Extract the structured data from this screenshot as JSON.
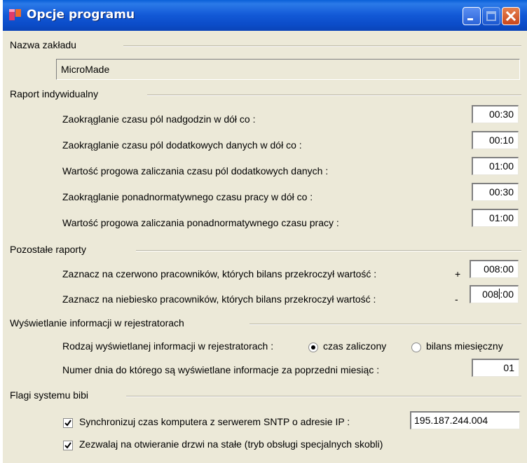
{
  "window": {
    "title": "Opcje programu"
  },
  "titlebar_buttons": {
    "minimize": "minimize-icon",
    "maximize": "maximize-icon",
    "close": "close-icon"
  },
  "company": {
    "group_label": "Nazwa zakładu",
    "value": "MicroMade"
  },
  "individual_report": {
    "group_label": "Raport indywidualny",
    "rows": [
      {
        "label": "Zaokrąglanie czasu pól nadgodzin w dół co :",
        "value": "00:30"
      },
      {
        "label": "Zaokrąglanie czasu pól dodatkowych danych w dół co :",
        "value": "00:10"
      },
      {
        "label": "Wartość progowa zaliczania czasu pól dodatkowych danych :",
        "value": "01:00"
      },
      {
        "label": "Zaokrąglanie ponadnormatywnego czasu pracy w dół co :",
        "value": "00:30"
      },
      {
        "label": "Wartość progowa zaliczania ponadnormatywnego czasu pracy :",
        "value": "01:00"
      }
    ]
  },
  "other_reports": {
    "group_label": "Pozostałe raporty",
    "rows": [
      {
        "label": "Zaznacz na czerwono pracowników, których bilans przekroczył wartość :",
        "sign": "+",
        "value": "008:00"
      },
      {
        "label": "Zaznacz na niebiesko pracowników, których bilans przekroczył wartość :",
        "sign": "-",
        "value_before_cursor": "008",
        "value_after_cursor": ":00"
      }
    ]
  },
  "recorder_display": {
    "group_label": "Wyświetlanie informacji w rejestratorach",
    "type_label": "Rodzaj wyświetlanej informacji w rejestratorach :",
    "option_credited": "czas zaliczony",
    "option_balance": "bilans miesięczny",
    "selected": "czas zaliczony",
    "day_label": "Numer dnia do którego są wyświetlane informacje za poprzedni miesiąc :",
    "day_value": "01"
  },
  "bibi_flags": {
    "group_label": "Flagi systemu bibi",
    "sntp_label": "Synchronizuj czas komputera z serwerem SNTP o adresie IP :",
    "sntp_checked": true,
    "sntp_ip": "195.187.244.004",
    "door_label": "Zezwalaj na otwieranie drzwi na stałe (tryb obsługi specjalnych skobli)",
    "door_checked": true
  },
  "colors": {
    "titlebar": "#0a4cc8",
    "dialog_bg": "#ece9d8",
    "close_button": "#d2532a"
  }
}
